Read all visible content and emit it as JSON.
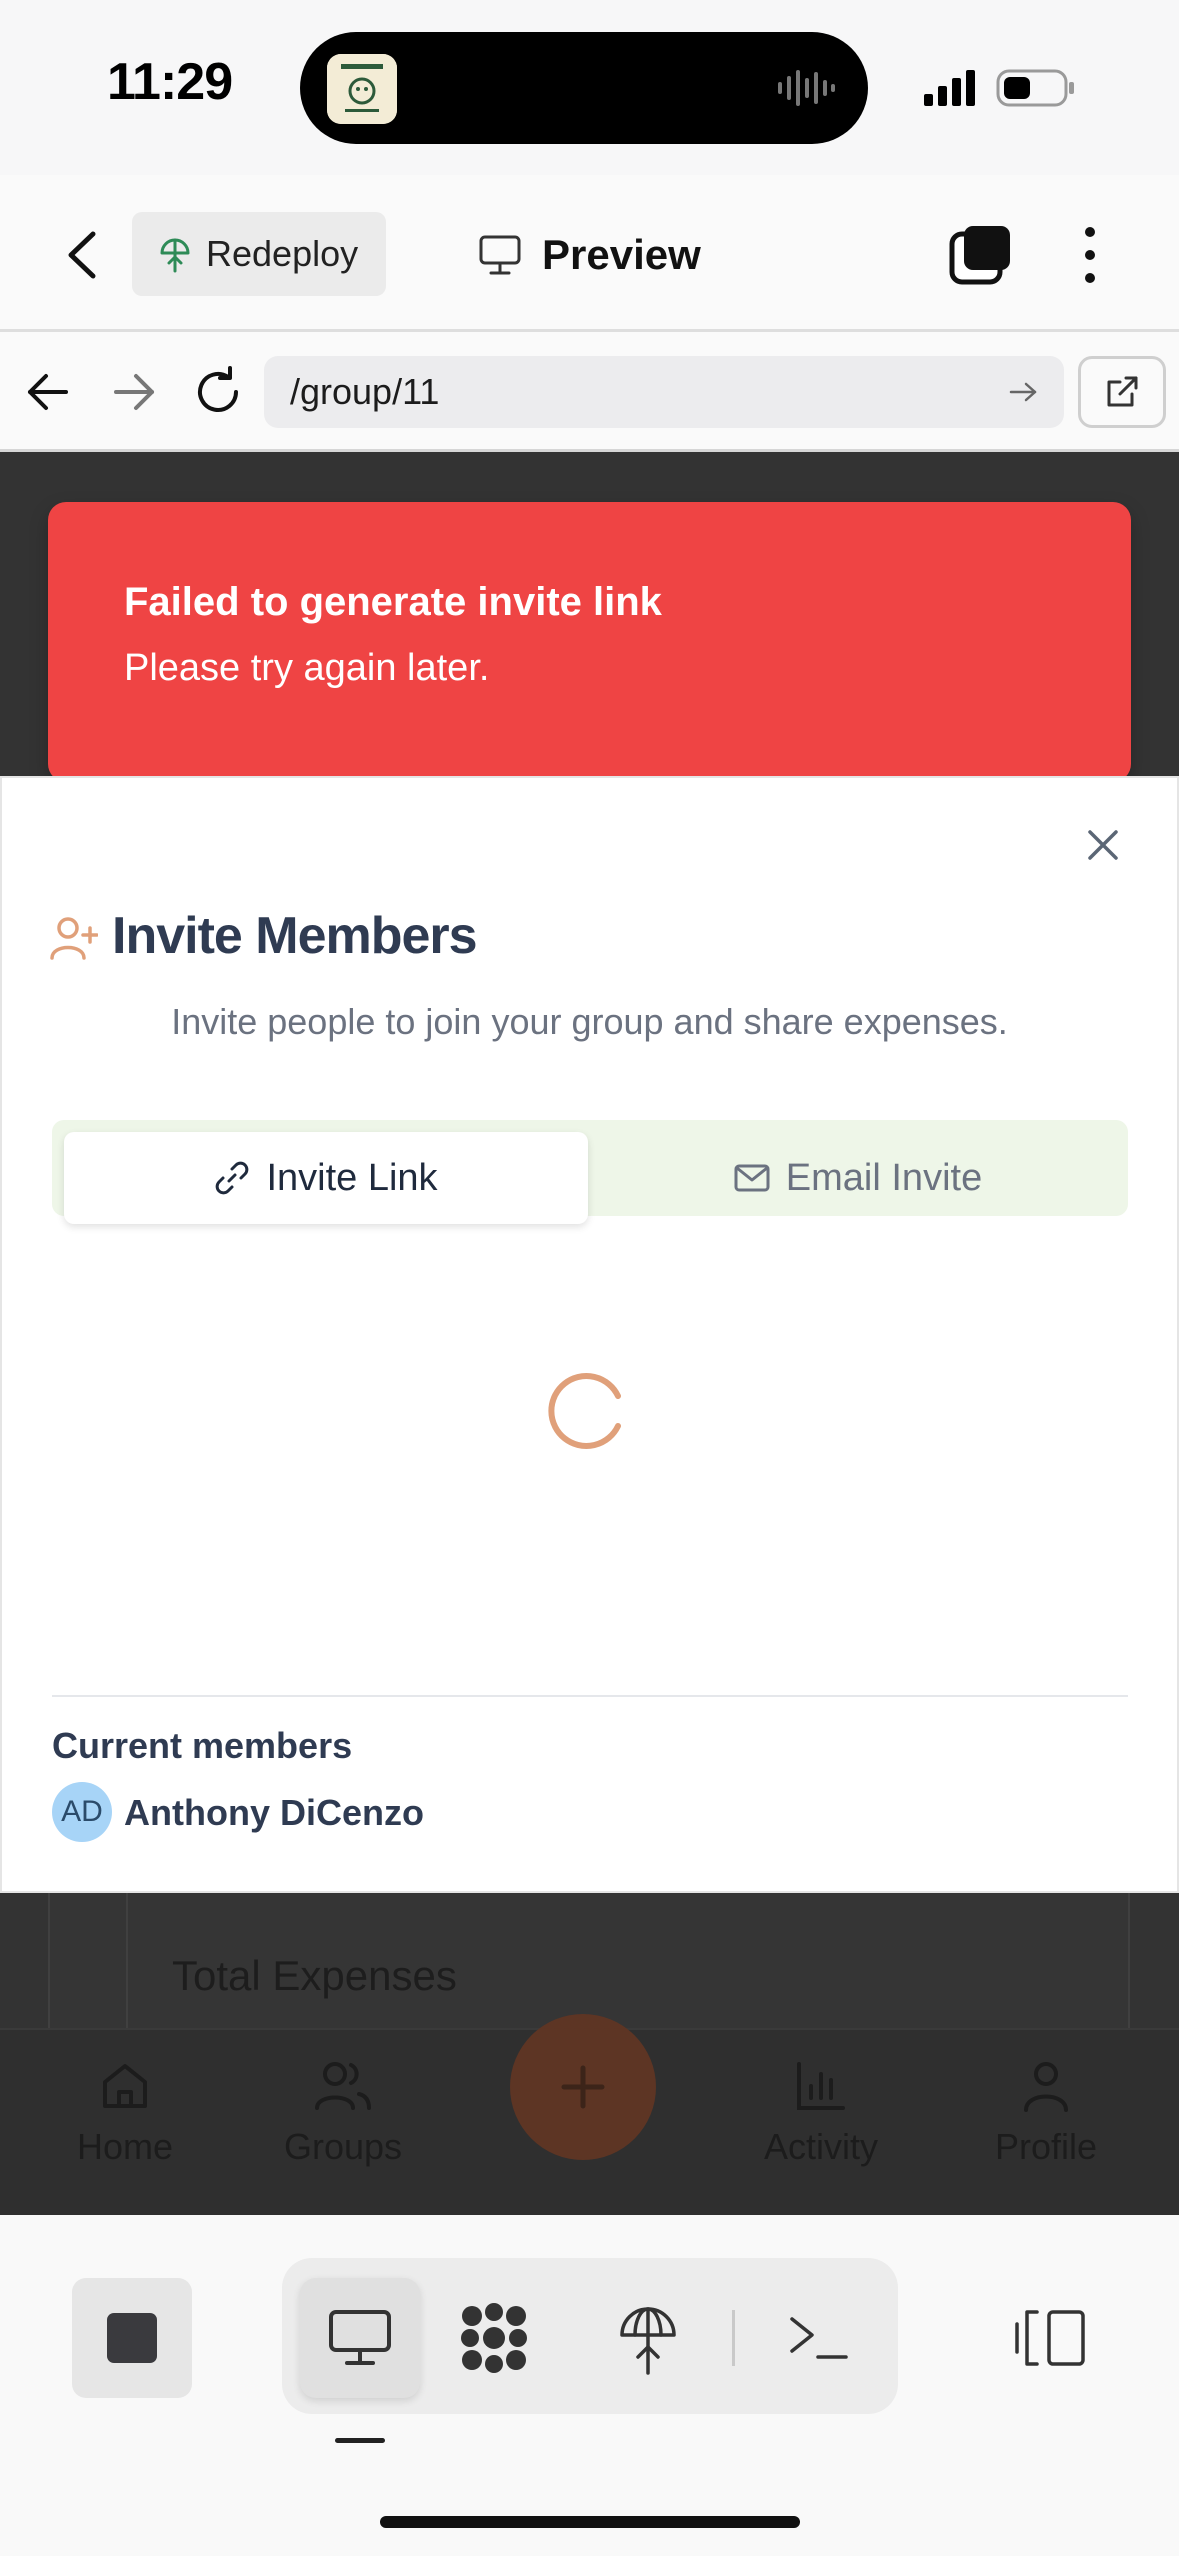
{
  "status_bar": {
    "time": "11:29"
  },
  "header": {
    "redeploy_label": "Redeploy",
    "preview_label": "Preview"
  },
  "browser": {
    "url": "/group/11"
  },
  "toast": {
    "title": "Failed to generate invite link",
    "message": "Please try again later."
  },
  "modal": {
    "title": "Invite Members",
    "description": "Invite people to join your group and share expenses.",
    "tabs": [
      {
        "label": "Invite Link",
        "icon": "link-icon",
        "selected": true
      },
      {
        "label": "Email Invite",
        "icon": "mail-icon",
        "selected": false
      }
    ],
    "members_heading": "Current members",
    "members": [
      {
        "initials": "AD",
        "name": "Anthony DiCenzo"
      }
    ]
  },
  "background_page": {
    "card_label": "Total Expenses",
    "nav": [
      {
        "label": "Home",
        "icon": "home-icon"
      },
      {
        "label": "Groups",
        "icon": "users-icon"
      },
      {
        "label": "Activity",
        "icon": "bar-chart-icon"
      },
      {
        "label": "Profile",
        "icon": "user-icon"
      }
    ]
  },
  "colors": {
    "toast_bg": "#ef4444",
    "accent_orange": "#e0a07a",
    "tabs_bg": "#eef6e8",
    "title_text": "#2f3b52",
    "avatar_bg": "#a7d4f7"
  }
}
